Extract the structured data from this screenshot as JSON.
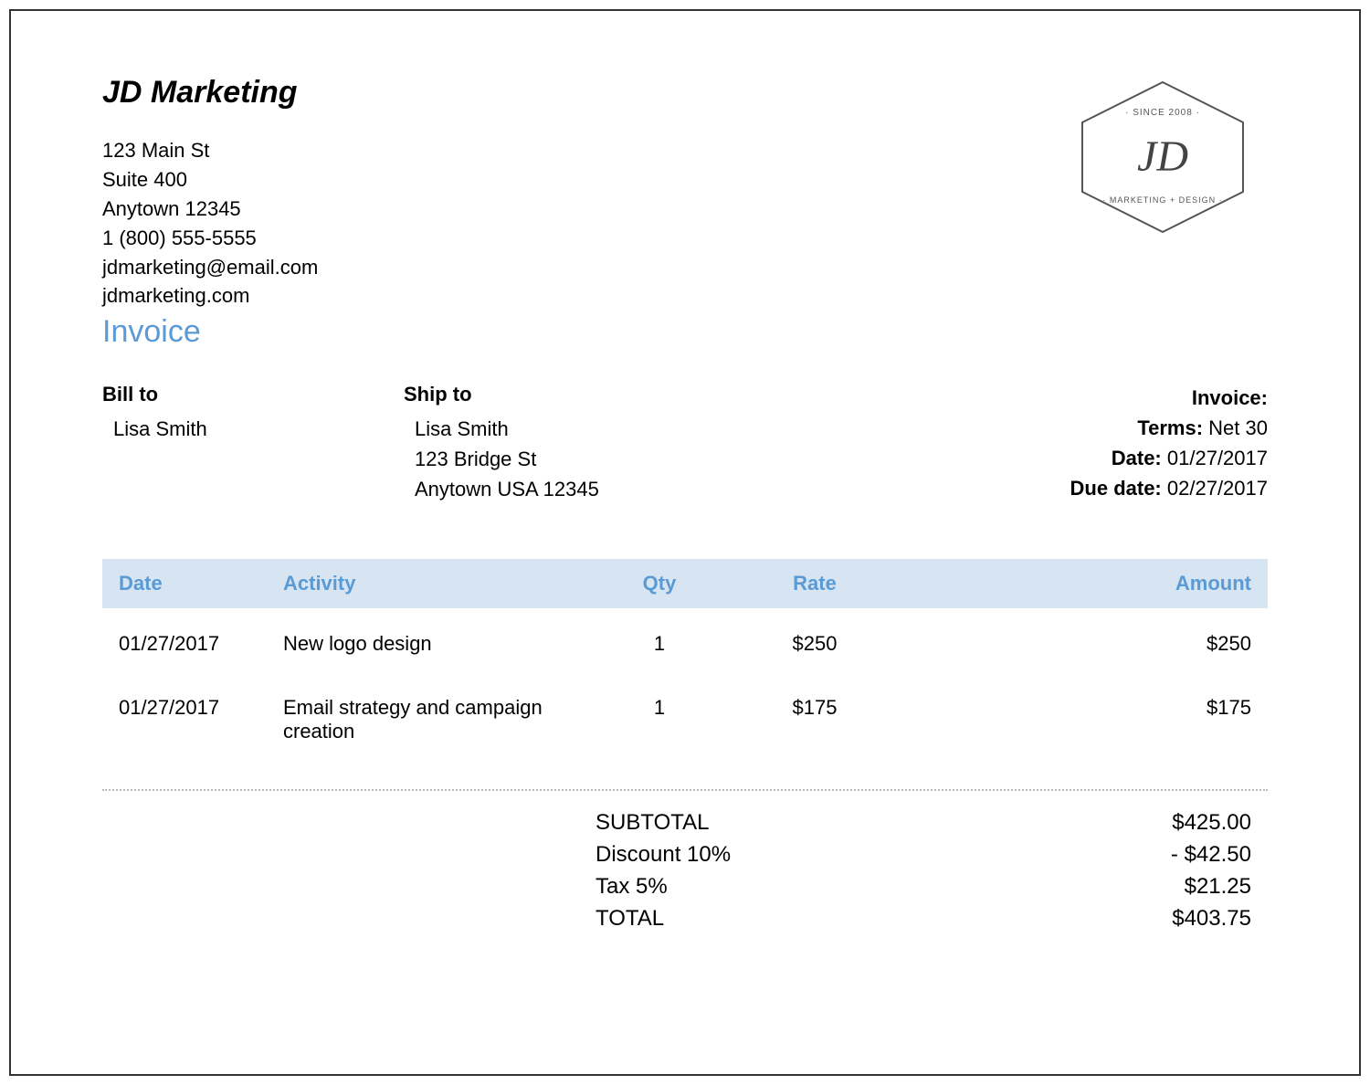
{
  "company": {
    "name": "JD Marketing",
    "address1": "123 Main St",
    "address2": "Suite 400",
    "city_zip": "Anytown 12345",
    "phone": "1 (800) 555-5555",
    "email": "jdmarketing@email.com",
    "website": "jdmarketing.com"
  },
  "logo": {
    "since": "· SINCE 2008 ·",
    "initials": "JD",
    "tagline": "· MARKETING + DESIGN ·"
  },
  "doc_title": "Invoice",
  "bill_to": {
    "label": "Bill to",
    "name": "Lisa Smith"
  },
  "ship_to": {
    "label": "Ship to",
    "name": "Lisa Smith",
    "address": "123 Bridge St",
    "city_zip": "Anytown USA 12345"
  },
  "meta": {
    "invoice_label": "Invoice:",
    "terms_label": "Terms:",
    "terms_value": "Net 30",
    "date_label": "Date:",
    "date_value": "01/27/2017",
    "due_label": "Due date:",
    "due_value": "02/27/2017"
  },
  "columns": {
    "date": "Date",
    "activity": "Activity",
    "qty": "Qty",
    "rate": "Rate",
    "amount": "Amount"
  },
  "items": [
    {
      "date": "01/27/2017",
      "activity": "New logo design",
      "qty": "1",
      "rate": "$250",
      "amount": "$250"
    },
    {
      "date": "01/27/2017",
      "activity": "Email strategy and campaign creation",
      "qty": "1",
      "rate": "$175",
      "amount": "$175"
    }
  ],
  "totals": {
    "subtotal_label": "SUBTOTAL",
    "subtotal_value": "$425.00",
    "discount_label": "Discount 10%",
    "discount_value": "- $42.50",
    "tax_label": "Tax 5%",
    "tax_value": "$21.25",
    "total_label": "TOTAL",
    "total_value": "$403.75"
  }
}
